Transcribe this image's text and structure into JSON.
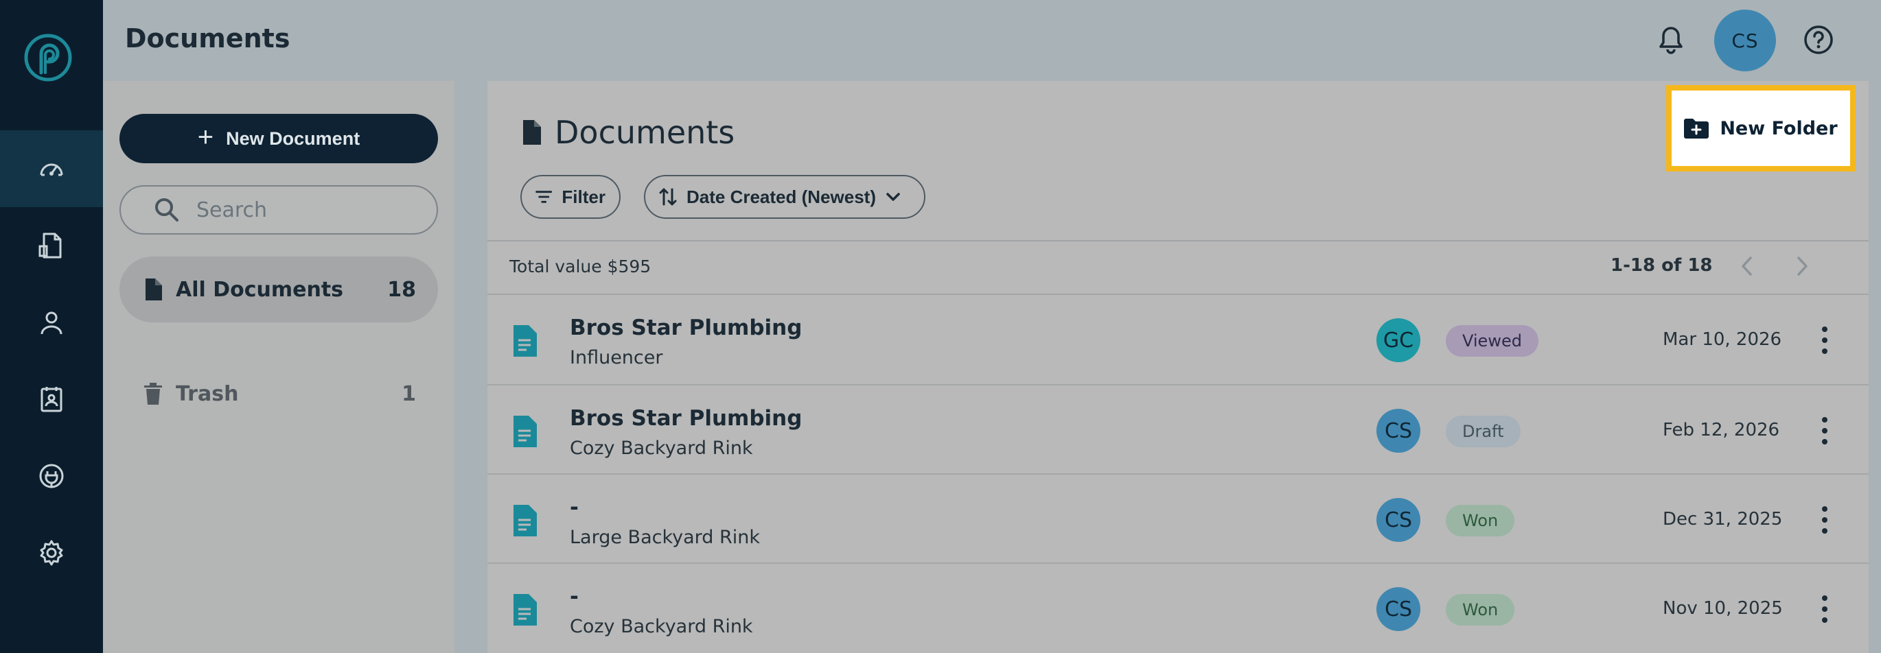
{
  "header": {
    "title": "Documents",
    "user_initials": "CS"
  },
  "sidebar": {
    "new_document_label": "New Document",
    "search_placeholder": "Search",
    "folders": [
      {
        "label": "All Documents",
        "count": "18"
      },
      {
        "label": "Trash",
        "count": "1"
      }
    ]
  },
  "main": {
    "title": "Documents",
    "new_folder_label": "New Folder",
    "filter_label": "Filter",
    "sort_label": "Date Created (Newest)",
    "total_value": "Total value $595",
    "pagination": "1-18 of 18",
    "rows": [
      {
        "title": "Bros Star Plumbing",
        "subtitle": "Influencer",
        "owner": "GC",
        "owner_color": "#1d9aa5",
        "status": "Viewed",
        "status_bg": "#a89bb6",
        "status_fg": "#2e2a4a",
        "date": "Mar 10, 2026"
      },
      {
        "title": "Bros Star Plumbing",
        "subtitle": "Cozy Backyard Rink",
        "owner": "CS",
        "owner_color": "#3f87b1",
        "status": "Draft",
        "status_bg": "#a6b1b9",
        "status_fg": "#41505b",
        "date": "Feb 12, 2026"
      },
      {
        "title": "-",
        "subtitle": "Large Backyard Rink",
        "owner": "CS",
        "owner_color": "#3f87b1",
        "status": "Won",
        "status_bg": "#9ab5a4",
        "status_fg": "#2d5a3c",
        "date": "Dec 31, 2025"
      },
      {
        "title": "-",
        "subtitle": "Cozy Backyard Rink",
        "owner": "CS",
        "owner_color": "#3f87b1",
        "status": "Won",
        "status_bg": "#9ab5a4",
        "status_fg": "#2d5a3c",
        "date": "Nov 10, 2025"
      }
    ]
  },
  "colors": {
    "rail": "#0b1d2c",
    "accent_teal": "#1d8a99",
    "highlight": "#f5b81c"
  },
  "icons": {
    "rail": [
      "logo-icon",
      "dashboard-icon",
      "documents-icon",
      "user-icon",
      "contacts-icon",
      "integrations-icon",
      "settings-icon"
    ],
    "header": [
      "bell-icon",
      "help-icon"
    ]
  }
}
